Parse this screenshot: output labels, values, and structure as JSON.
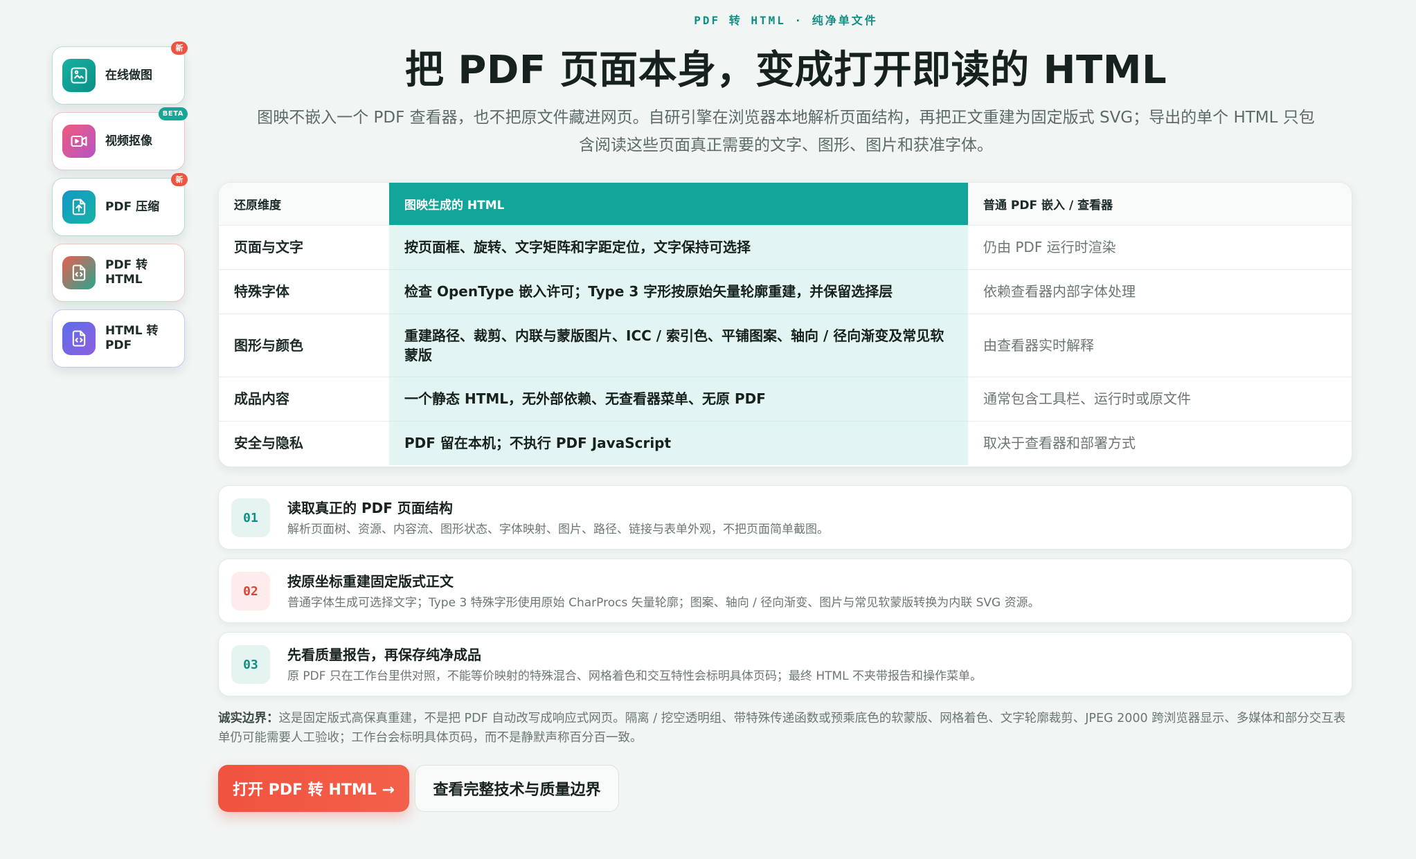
{
  "sidebar": {
    "items": [
      {
        "label": "在线做图",
        "badge": "新",
        "icon": "image-edit-icon"
      },
      {
        "label": "视频抠像",
        "badge": "BETA",
        "icon": "video-icon"
      },
      {
        "label": "PDF 压缩",
        "badge": "新",
        "icon": "file-upload-icon"
      },
      {
        "label": "PDF 转 HTML",
        "badge": "",
        "icon": "file-code-icon"
      },
      {
        "label": "HTML 转 PDF",
        "badge": "",
        "icon": "file-code-icon"
      }
    ]
  },
  "hero": {
    "eyebrow": "PDF 转 HTML · 纯净单文件",
    "title": "把 PDF 页面本身，变成打开即读的 HTML",
    "lead": "图映不嵌入一个 PDF 查看器，也不把原文件藏进网页。自研引擎在浏览器本地解析页面结构，再把正文重建为固定版式 SVG；导出的单个 HTML 只包含阅读这些页面真正需要的文字、图形、图片和获准字体。"
  },
  "table": {
    "headers": [
      "还原维度",
      "图映生成的 HTML",
      "普通 PDF 嵌入 / 查看器"
    ],
    "rows": [
      {
        "dim": "页面与文字",
        "ours": "按页面框、旋转、文字矩阵和字距定位，文字保持可选择",
        "other": "仍由 PDF 运行时渲染"
      },
      {
        "dim": "特殊字体",
        "ours": "检查 OpenType 嵌入许可；Type 3 字形按原始矢量轮廓重建，并保留选择层",
        "other": "依赖查看器内部字体处理"
      },
      {
        "dim": "图形与颜色",
        "ours": "重建路径、裁剪、内联与蒙版图片、ICC / 索引色、平铺图案、轴向 / 径向渐变及常见软蒙版",
        "other": "由查看器实时解释"
      },
      {
        "dim": "成品内容",
        "ours": "一个静态 HTML，无外部依赖、无查看器菜单、无原 PDF",
        "other": "通常包含工具栏、运行时或原文件"
      },
      {
        "dim": "安全与隐私",
        "ours": "PDF 留在本机；不执行 PDF JavaScript",
        "other": "取决于查看器和部署方式"
      }
    ]
  },
  "steps": [
    {
      "num": "01",
      "title": "读取真正的 PDF 页面结构",
      "desc": "解析页面树、资源、内容流、图形状态、字体映射、图片、路径、链接与表单外观，不把页面简单截图。"
    },
    {
      "num": "02",
      "title": "按原坐标重建固定版式正文",
      "desc": "普通字体生成可选择文字；Type 3 特殊字形使用原始 CharProcs 矢量轮廓；图案、轴向 / 径向渐变、图片与常见软蒙版转换为内联 SVG 资源。"
    },
    {
      "num": "03",
      "title": "先看质量报告，再保存纯净成品",
      "desc": "原 PDF 只在工作台里供对照，不能等价映射的特殊混合、网格着色和交互特性会标明具体页码；最终 HTML 不夹带报告和操作菜单。"
    }
  ],
  "note": {
    "label": "诚实边界：",
    "text": "这是固定版式高保真重建，不是把 PDF 自动改写成响应式网页。隔离 / 挖空透明组、带特殊传递函数或预乘底色的软蒙版、网格着色、文字轮廓裁剪、JPEG 2000 跨浏览器显示、多媒体和部分交互表单仍可能需要人工验收；工作台会标明具体页码，而不是静默声称百分百一致。"
  },
  "actions": {
    "primary": "打开 PDF 转 HTML →",
    "secondary": "查看完整技术与质量边界"
  },
  "colors": {
    "accent": "#12a69a",
    "accent_light": "#e3f5f2",
    "cta": "#f0533f",
    "background": "#f1f5f4"
  }
}
